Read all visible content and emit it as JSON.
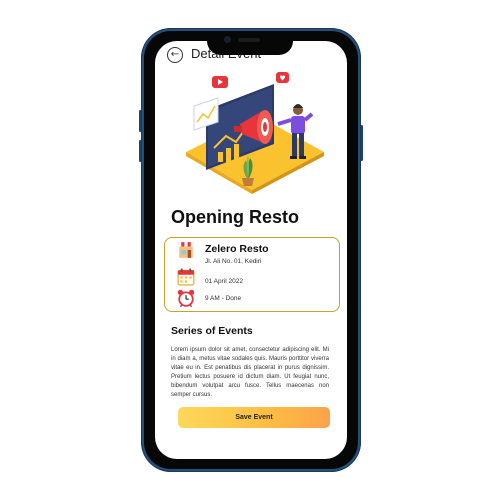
{
  "header": {
    "title": "Detail Event",
    "back_icon": "arrow-left-icon"
  },
  "event": {
    "title": "Opening Resto"
  },
  "info": {
    "venue_name": "Zelero Resto",
    "address": "Jl. Ali No. 01, Kediri",
    "date": "01 April 2022",
    "time": "9 AM - Done",
    "icons": [
      "store-icon",
      "calendar-icon",
      "alarm-clock-icon"
    ]
  },
  "series": {
    "title": "Series of Events",
    "description": "Lorem ipsum dolor sit amet, consectetur adipiscing elit. Mi in diam a, metus vitae sodales quis. Mauris porttitor viverra vitae eu in. Est penatibus dis placerat in purus dignissim. Pretium lectus posuere id dictum diam. Ut feugiat nunc, bibendum volutpat arcu fusce. Tellus maecenas non semper cursus."
  },
  "actions": {
    "save_label": "Save Event"
  },
  "colors": {
    "accent_start": "#fdd85a",
    "accent_end": "#fca24a",
    "card_border": "#c9a227",
    "phone_frame": "#25507a"
  }
}
